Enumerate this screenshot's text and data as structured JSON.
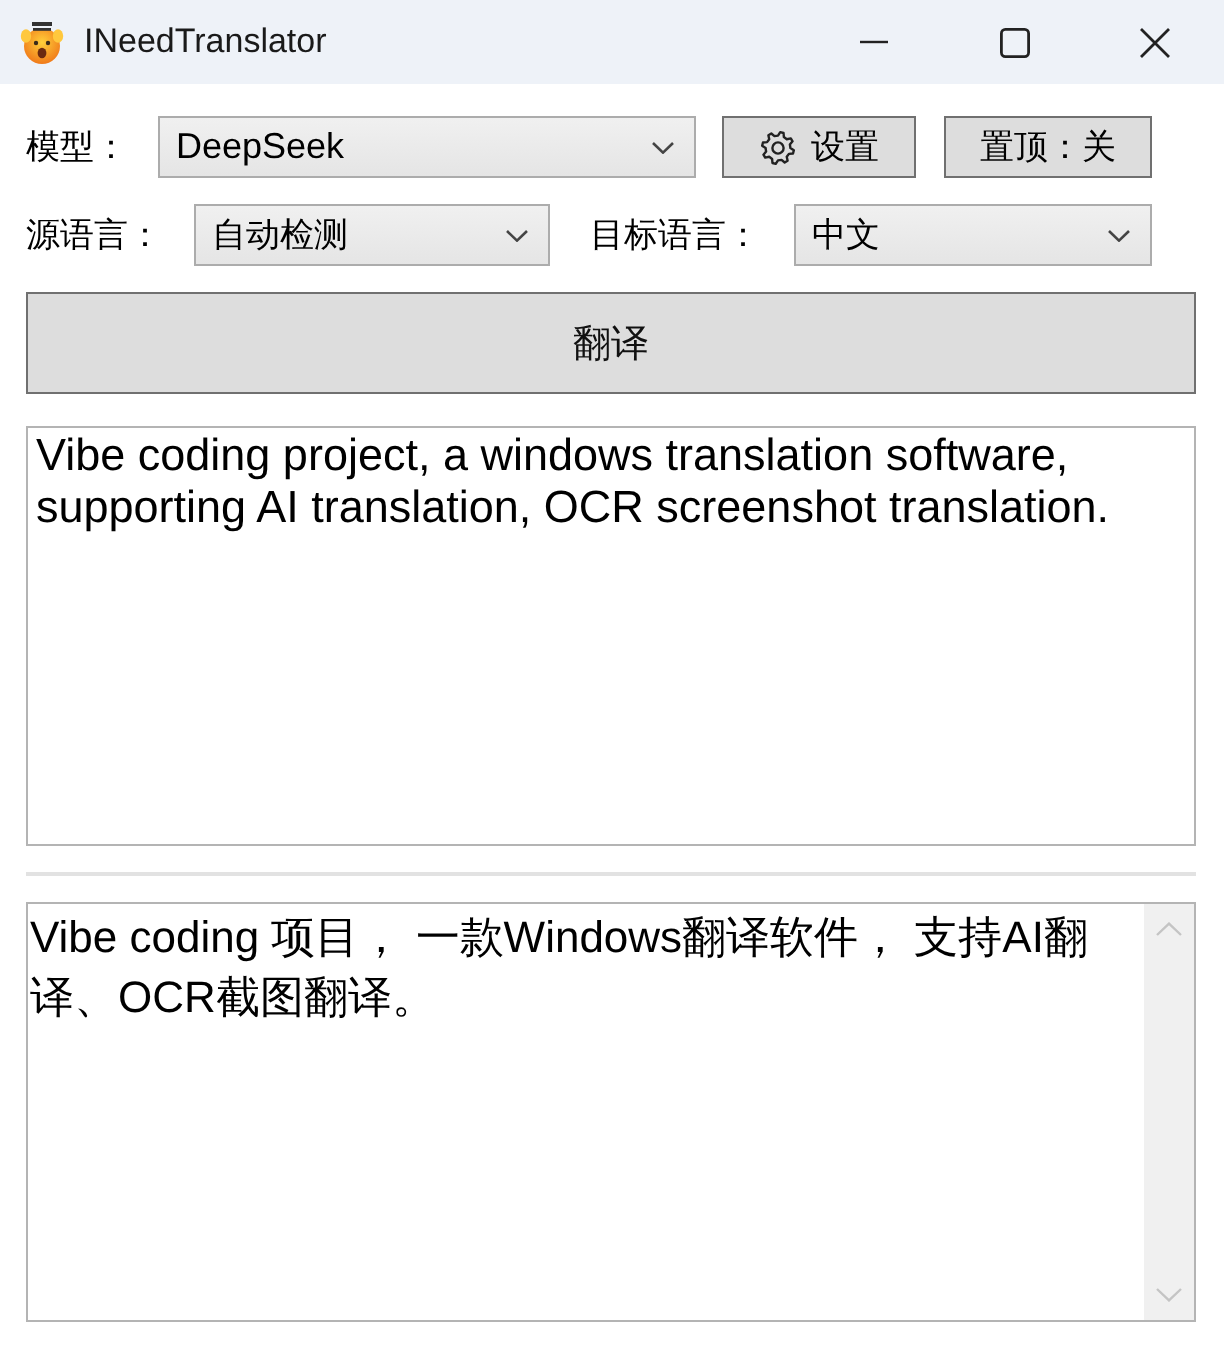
{
  "window": {
    "title": "INeedTranslator"
  },
  "model": {
    "label": "模型：",
    "value": "DeepSeek"
  },
  "settings_button": {
    "label": "设置"
  },
  "pin_button": {
    "label": "置顶：关"
  },
  "source_language": {
    "label": "源语言：",
    "value": "自动检测"
  },
  "target_language": {
    "label": "目标语言：",
    "value": "中文"
  },
  "translate_button": {
    "label": "翻译"
  },
  "input_text": "Vibe coding project, a windows translation software, supporting AI translation, OCR screenshot translation.",
  "output_text": "Vibe coding 项目， 一款Windows翻译软件， 支持AI翻译、OCR截图翻译。"
}
